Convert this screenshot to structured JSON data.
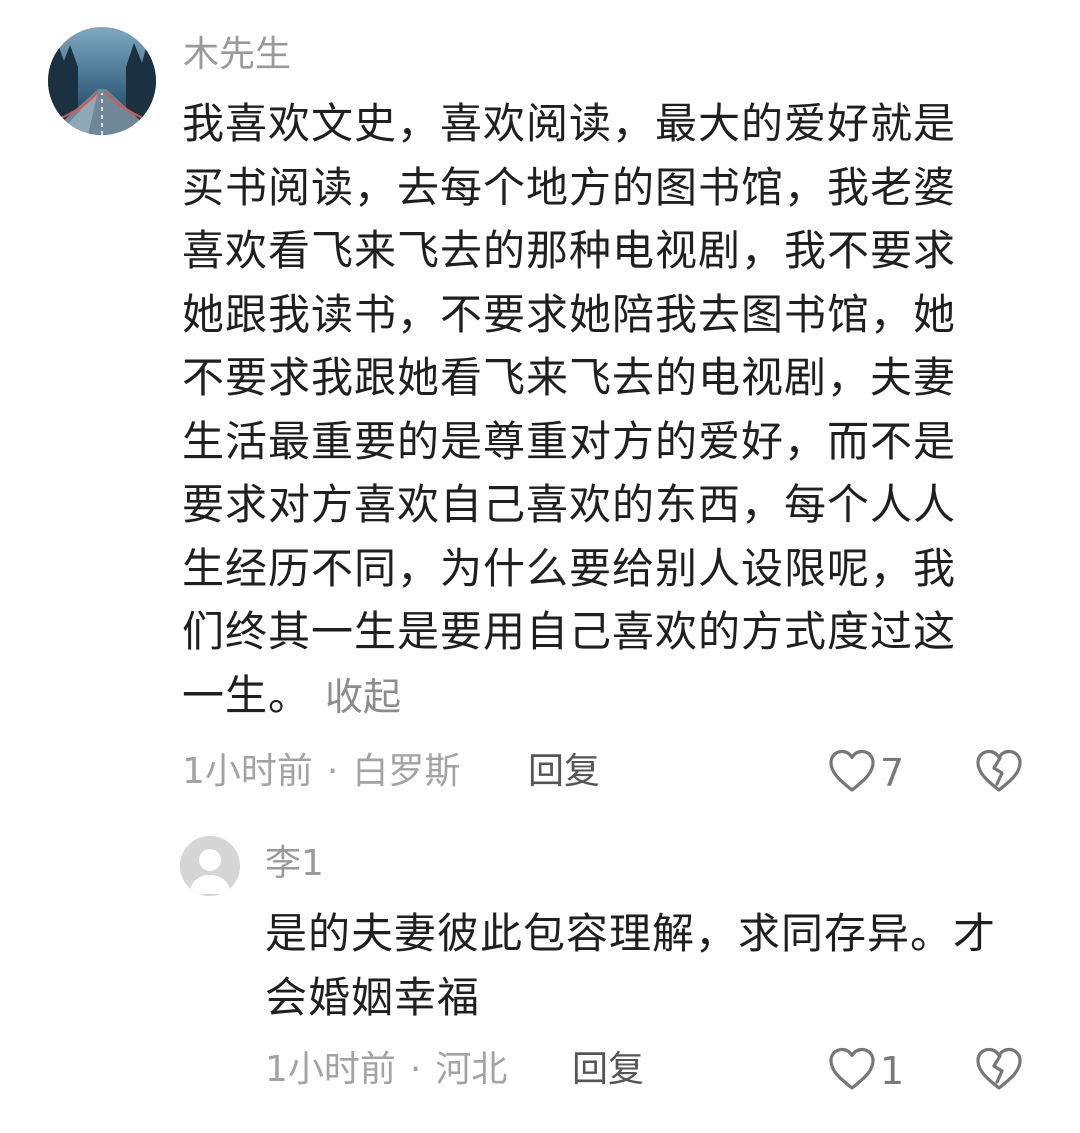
{
  "comment": {
    "username": "木先生",
    "text_lines": [
      "我喜欢文史，喜欢阅读，最大的爱好就是",
      "买书阅读，去每个地方的图书馆，我老婆",
      "喜欢看飞来飞去的那种电视剧，我不要求",
      "她跟我读书，不要求她陪我去图书馆，她",
      "不要求我跟她看飞来飞去的电视剧，夫妻",
      "生活最重要的是尊重对方的爱好，而不是",
      "要求对方喜欢自己喜欢的东西，每个人人",
      "生经历不同，为什么要给别人设限呢，我",
      "们终其一生是要用自己喜欢的方式度过这",
      "一生。"
    ],
    "collapse_label": "收起",
    "time": "1小时前",
    "location": "白罗斯",
    "reply_label": "回复",
    "like_count": "7",
    "like_icon": "heart-outline-icon",
    "dislike_icon": "broken-heart-icon"
  },
  "reply": {
    "username": "李1",
    "text_lines": [
      "是的夫妻彼此包容理解，求同存异。才",
      "会婚姻幸福"
    ],
    "time": "1小时前",
    "location": "河北",
    "reply_label": "回复",
    "like_count": "1",
    "like_icon": "heart-outline-icon",
    "dislike_icon": "broken-heart-icon"
  },
  "separator": "·",
  "colors": {
    "username": "#9a9a9a",
    "text": "#1f1f1f",
    "meta": "#a3a3a3",
    "icon": "#777777"
  }
}
